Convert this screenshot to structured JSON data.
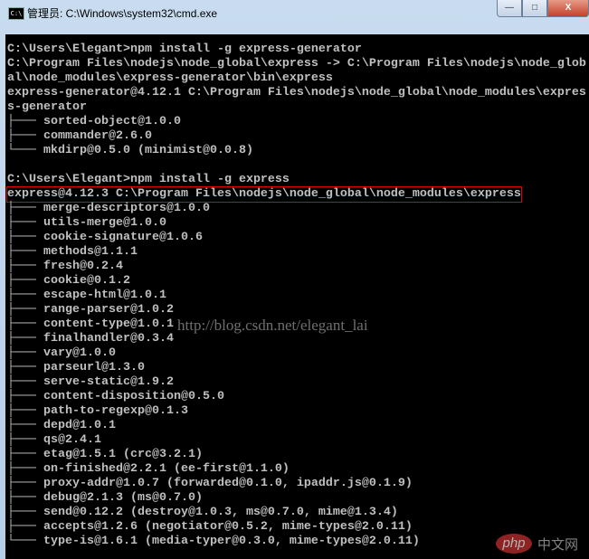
{
  "window": {
    "title": "管理员: C:\\Windows\\system32\\cmd.exe",
    "icon_label": "C:\\",
    "buttons": {
      "minimize": "—",
      "maximize": "□",
      "close": "X"
    }
  },
  "console": {
    "lines": [
      "C:\\Users\\Elegant>npm install -g express-generator",
      "C:\\Program Files\\nodejs\\node_global\\express -> C:\\Program Files\\nodejs\\node_glob",
      "al\\node_modules\\express-generator\\bin\\express",
      "express-generator@4.12.1 C:\\Program Files\\nodejs\\node_global\\node_modules\\expres",
      "s-generator",
      "├─── sorted-object@1.0.0",
      "├─── commander@2.6.0",
      "└─── mkdirp@0.5.0 (minimist@0.0.8)",
      "",
      "C:\\Users\\Elegant>npm install -g express",
      "express@4.12.3 C:\\Program Files\\nodejs\\node_global\\node_modules\\express",
      "├─── merge-descriptors@1.0.0",
      "├─── utils-merge@1.0.0",
      "├─── cookie-signature@1.0.6",
      "├─── methods@1.1.1",
      "├─── fresh@0.2.4",
      "├─── cookie@0.1.2",
      "├─── escape-html@1.0.1",
      "├─── range-parser@1.0.2",
      "├─── content-type@1.0.1",
      "├─── finalhandler@0.3.4",
      "├─── vary@1.0.0",
      "├─── parseurl@1.3.0",
      "├─── serve-static@1.9.2",
      "├─── content-disposition@0.5.0",
      "├─── path-to-regexp@0.1.3",
      "├─── depd@1.0.1",
      "├─── qs@2.4.1",
      "├─── etag@1.5.1 (crc@3.2.1)",
      "├─── on-finished@2.2.1 (ee-first@1.1.0)",
      "├─── proxy-addr@1.0.7 (forwarded@0.1.0, ipaddr.js@0.1.9)",
      "├─── debug@2.1.3 (ms@0.7.0)",
      "├─── send@0.12.2 (destroy@1.0.3, ms@0.7.0, mime@1.3.4)",
      "├─── accepts@1.2.6 (negotiator@0.5.2, mime-types@2.0.11)",
      "└─── type-is@1.6.1 (media-typer@0.3.0, mime-types@2.0.11)"
    ],
    "highlighted_line": 10,
    "highlight_color": "#e00000"
  },
  "watermark": "http://blog.csdn.net/elegant_lai",
  "logo": {
    "php": "php",
    "cn": "中文网"
  }
}
